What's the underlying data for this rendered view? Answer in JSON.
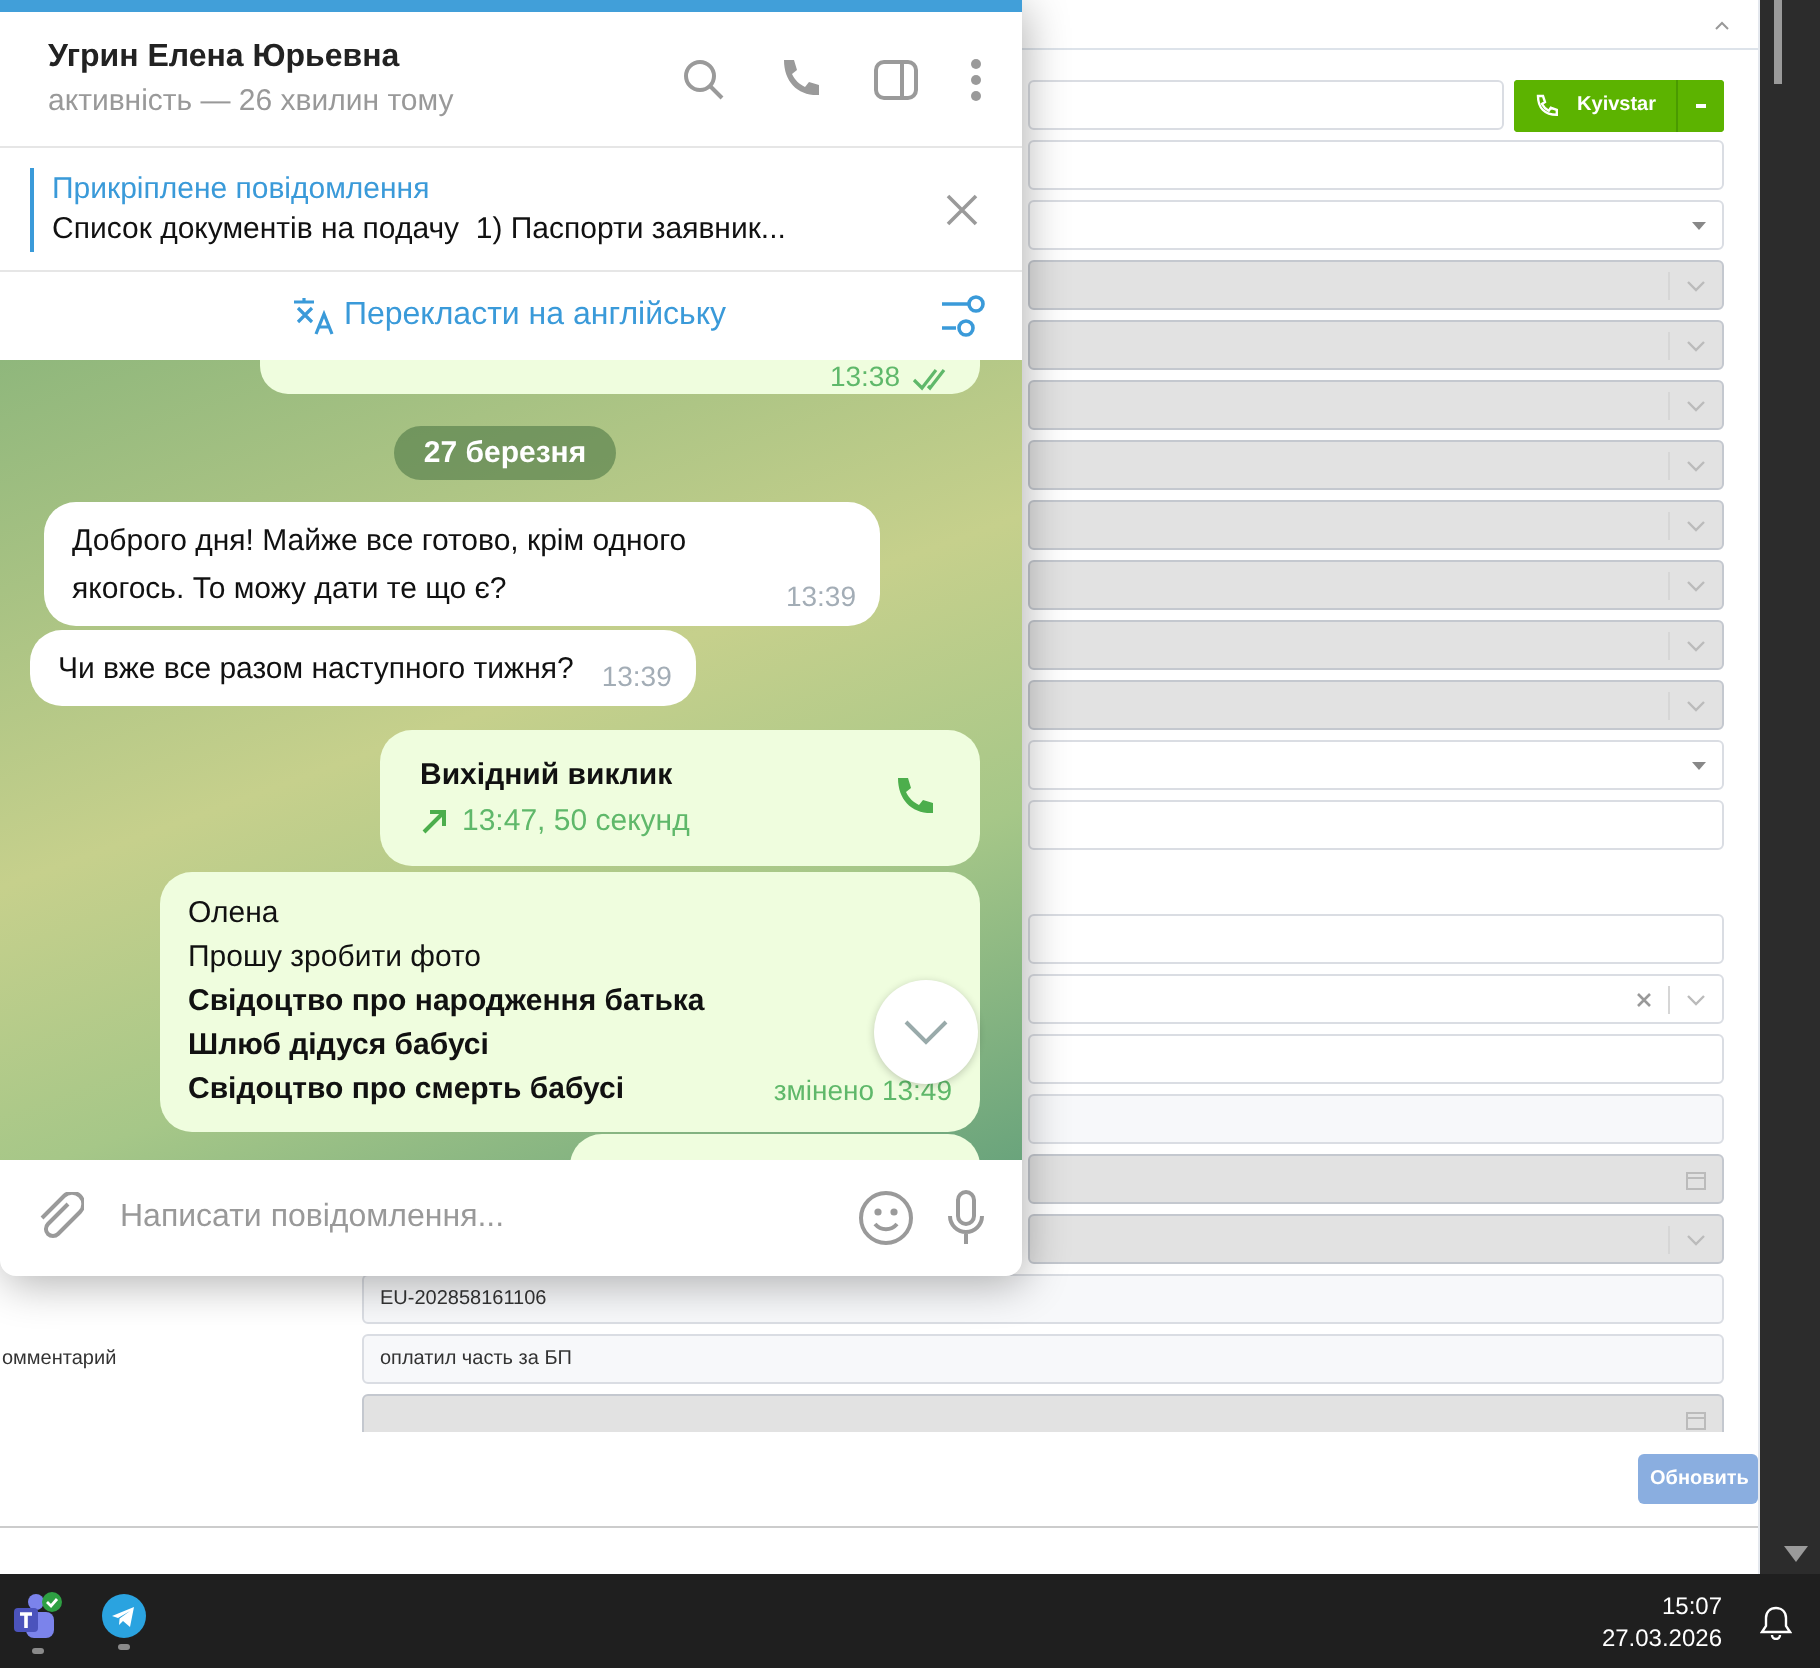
{
  "telegram": {
    "contact_name": "Угрин Елена Юрьевна",
    "status": "активність — 26 хвилин тому",
    "pinned": {
      "title": "Прикріплене повідомлення",
      "text": "Список документів на подачу  1) Паспорти заявник..."
    },
    "translate": "Перекласти на англійську",
    "messages": [
      {
        "kind": "partial-out",
        "time": "13:38",
        "read": true
      },
      {
        "kind": "date",
        "text": "27 березня"
      },
      {
        "kind": "in",
        "text": "Доброго дня! Майже все готово, крім одного якогось. То можу дати те що є?",
        "time": "13:39"
      },
      {
        "kind": "in",
        "text": "Чи вже все разом наступного тижня?",
        "time": "13:39"
      },
      {
        "kind": "call",
        "title": "Вихідний виклик",
        "detail": "13:47, 50 секунд"
      },
      {
        "kind": "out",
        "lines": [
          "Олена",
          "Прошу зробити фото",
          "**Свідоцтво про народження батька**",
          "**Шлюб дідуся бабусі**",
          "**Свідоцтво про смерть бабусі**"
        ],
        "time": "змінено 13:49"
      },
      {
        "kind": "partial-out-bottom"
      }
    ],
    "composer": {
      "placeholder": "Написати повідомлення..."
    }
  },
  "crm": {
    "sections": [
      {
        "fields": [
          {
            "kind": "phone",
            "disabled": false,
            "button": "Kyivstar"
          },
          {
            "kind": "text",
            "disabled": false
          },
          {
            "kind": "select",
            "disabled": false
          },
          {
            "kind": "combo",
            "disabled": true
          },
          {
            "kind": "combo",
            "disabled": true
          },
          {
            "kind": "combo",
            "disabled": true
          },
          {
            "kind": "combo",
            "disabled": true
          },
          {
            "kind": "combo",
            "disabled": true
          },
          {
            "kind": "combo",
            "disabled": true
          },
          {
            "kind": "combo",
            "disabled": true
          },
          {
            "kind": "combo",
            "disabled": true
          },
          {
            "kind": "select",
            "disabled": false
          },
          {
            "kind": "text",
            "disabled": false
          }
        ]
      },
      {
        "fields": [
          {
            "kind": "text",
            "disabled": false
          },
          {
            "kind": "combo-clear",
            "disabled": false
          },
          {
            "kind": "text",
            "disabled": false
          },
          {
            "kind": "readonly"
          },
          {
            "kind": "date",
            "disabled": true
          },
          {
            "kind": "combo",
            "disabled": true
          },
          {
            "kind": "readonly",
            "value": "EU-202858161106"
          },
          {
            "kind": "readonly",
            "label": "омментарий",
            "value": "оплатил часть за БП"
          },
          {
            "kind": "date",
            "disabled": true
          }
        ]
      }
    ],
    "update_button": "Обновить"
  },
  "taskbar": {
    "time": "15:07",
    "date": "27.03.2026"
  }
}
